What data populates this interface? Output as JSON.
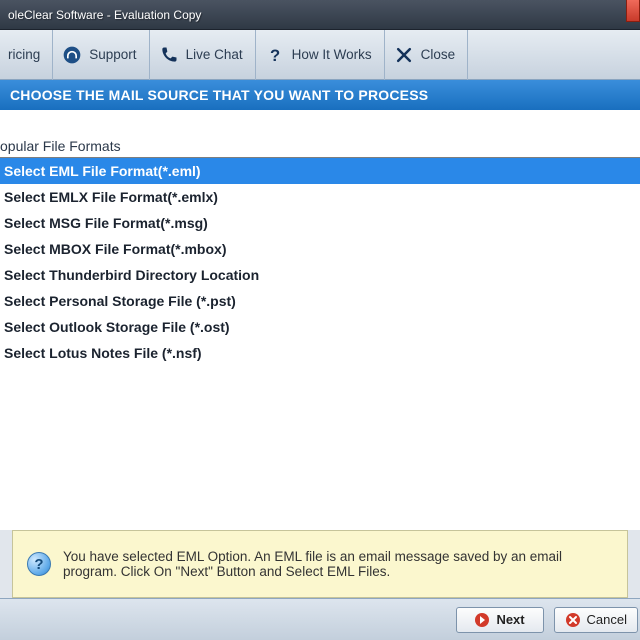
{
  "window": {
    "title": "oleClear Software - Evaluation Copy"
  },
  "toolbar": {
    "pricing": "ricing",
    "support": "Support",
    "livechat": "Live Chat",
    "howitworks": "How It Works",
    "close": "Close"
  },
  "header": "CHOOSE THE MAIL SOURCE THAT YOU WANT TO PROCESS",
  "section_label": "opular File Formats",
  "formats": [
    "Select EML File Format(*.eml)",
    "Select EMLX File Format(*.emlx)",
    "Select MSG File Format(*.msg)",
    "Select MBOX File Format(*.mbox)",
    "Select Thunderbird Directory Location",
    "Select Personal Storage File (*.pst)",
    "Select Outlook Storage File (*.ost)",
    "Select Lotus Notes File (*.nsf)"
  ],
  "selected_index": 0,
  "info_text": "You have selected EML Option. An EML file is an email message saved by an email program. Click On \"Next\" Button and Select EML Files.",
  "buttons": {
    "next": "Next",
    "cancel": "Cancel"
  },
  "colors": {
    "selection": "#2a88e8",
    "headerband": "#2a7fd0",
    "info_bg": "#fbf7ce"
  }
}
